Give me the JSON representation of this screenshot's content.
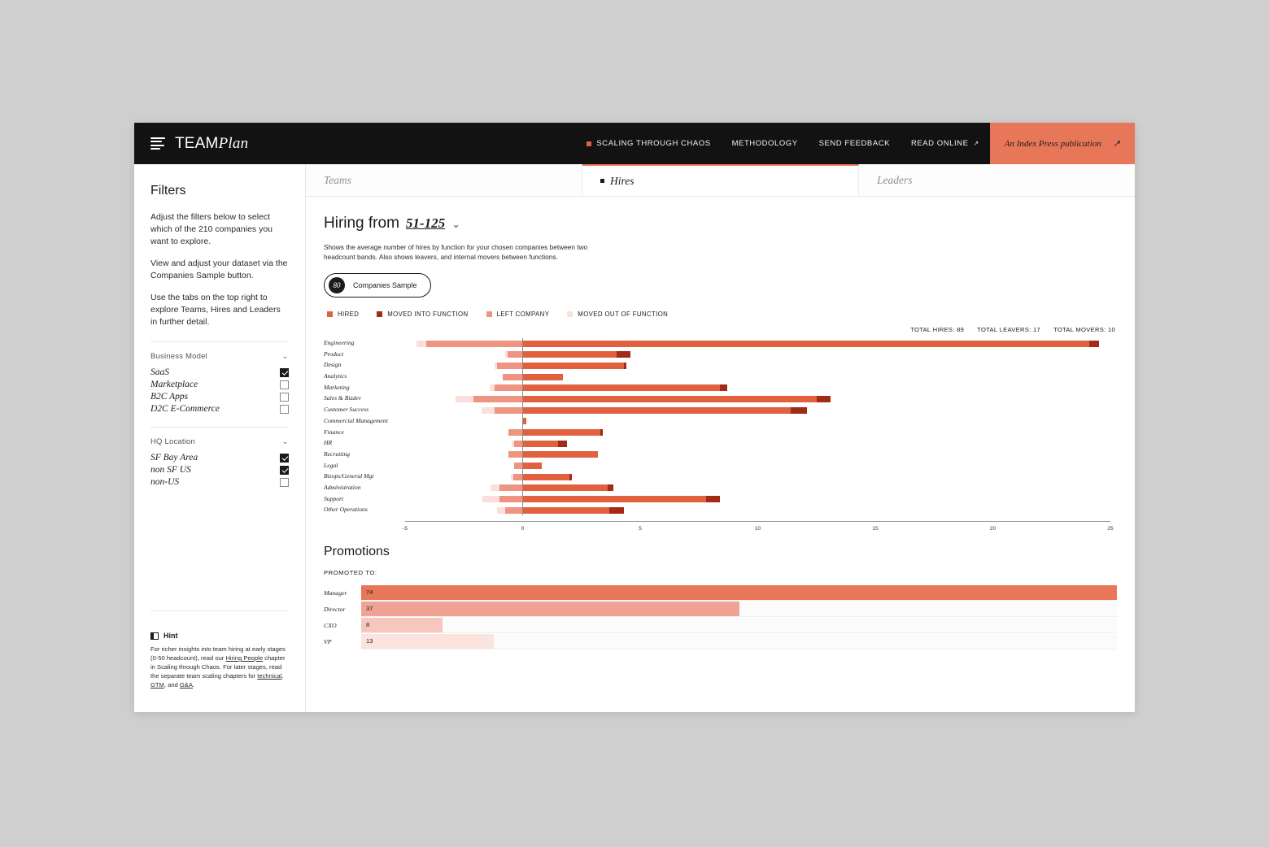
{
  "brand": {
    "name_bold": "TEAM",
    "name_italic": "Plan",
    "menu_icon": "hamburger-icon"
  },
  "topnav": {
    "items": [
      {
        "label": "SCALING THROUGH CHAOS",
        "has_square": true,
        "external": false
      },
      {
        "label": "METHODOLOGY",
        "has_square": false,
        "external": false
      },
      {
        "label": "SEND FEEDBACK",
        "has_square": false,
        "external": false
      },
      {
        "label": "READ ONLINE",
        "has_square": false,
        "external": true
      }
    ],
    "publication": "An Index Press publication",
    "publication_arrow": "↗"
  },
  "sidebar": {
    "title": "Filters",
    "paragraphs": [
      "Adjust the filters below to select which of the 210 companies you want to explore.",
      "View and adjust your dataset via the Companies Sample button.",
      "Use the tabs on the top right to explore Teams, Hires and Leaders in further detail."
    ],
    "groups": [
      {
        "title": "Business Model",
        "options": [
          {
            "label": "SaaS",
            "checked": true
          },
          {
            "label": "Marketplace",
            "checked": false
          },
          {
            "label": "B2C Apps",
            "checked": false
          },
          {
            "label": "D2C E-Commerce",
            "checked": false
          }
        ]
      },
      {
        "title": "HQ Location",
        "options": [
          {
            "label": "SF Bay Area",
            "checked": true
          },
          {
            "label": "non SF US",
            "checked": true
          },
          {
            "label": "non-US",
            "checked": false
          }
        ]
      }
    ],
    "hint": {
      "title": "Hint",
      "text_parts": [
        {
          "t": "For richer insights into team hiring at early stages (0-50 headcount), read our ",
          "u": false
        },
        {
          "t": "Hiring People",
          "u": true
        },
        {
          "t": " chapter in Scaling through Chaos. For later stages, read the separate team scaling chapters for ",
          "u": false
        },
        {
          "t": "technical",
          "u": true
        },
        {
          "t": ", ",
          "u": false
        },
        {
          "t": "GTM",
          "u": true
        },
        {
          "t": ", and ",
          "u": false
        },
        {
          "t": "G&A",
          "u": true
        },
        {
          "t": ".",
          "u": false
        }
      ]
    }
  },
  "tabs": [
    {
      "label": "Teams",
      "active": false
    },
    {
      "label": "Hires",
      "active": true
    },
    {
      "label": "Leaders",
      "active": false
    }
  ],
  "main": {
    "heading_prefix": "Hiring from",
    "heading_band": "51-125",
    "chevron": "⌄",
    "description": "Shows the average number of hires by function for your chosen companies between two headcount bands. Also shows leavers, and internal movers between functions.",
    "sample_button": {
      "badge": "80",
      "label": "Companies Sample"
    },
    "totals": [
      "TOTAL HIRES: 89",
      "TOTAL LEAVERS: 17",
      "TOTAL MOVERS: 10"
    ],
    "promotions_title": "Promotions",
    "promoted_to_label": "PROMOTED TO:"
  },
  "colors": {
    "hired": "#E1613F",
    "moved_into_function": "#A02B16",
    "left_company": "#EE9480",
    "moved_out_of_function": "#FAE0DA",
    "accent": "#E8775A",
    "dark": "#121212"
  },
  "chart_data": [
    {
      "type": "bar",
      "orientation": "horizontal",
      "title": "Hiring from 51-125",
      "xlabel": "",
      "ylabel": "",
      "xlim": [
        -5,
        25
      ],
      "xticks": [
        -5,
        0,
        5,
        10,
        15,
        20,
        25
      ],
      "grid": false,
      "legend": [
        {
          "name": "HIRED",
          "color": "#E1613F"
        },
        {
          "name": "MOVED INTO FUNCTION",
          "color": "#A02B16"
        },
        {
          "name": "LEFT COMPANY",
          "color": "#EE9480"
        },
        {
          "name": "MOVED OUT OF FUNCTION",
          "color": "#FAE0DA"
        }
      ],
      "categories": [
        "Engineering",
        "Product",
        "Design",
        "Analytics",
        "Marketing",
        "Sales & Bizdev",
        "Customer Success",
        "Commercial Management",
        "Finance",
        "HR",
        "Recruiting",
        "Legal",
        "Bizops/General Mgt",
        "Administration",
        "Support",
        "Other Operations"
      ],
      "series": [
        {
          "name": "HIRED",
          "values": [
            24.1,
            4.0,
            4.3,
            1.7,
            8.4,
            12.5,
            11.4,
            0.15,
            3.3,
            1.5,
            3.2,
            0.8,
            2.0,
            3.6,
            7.8,
            3.7
          ]
        },
        {
          "name": "MOVED INTO FUNCTION",
          "values": [
            0.4,
            0.6,
            0.1,
            0.0,
            0.3,
            0.6,
            0.7,
            0.0,
            0.1,
            0.4,
            0.0,
            0.0,
            0.1,
            0.25,
            0.6,
            0.6
          ]
        },
        {
          "name": "LEFT COMPANY",
          "values": [
            -4.1,
            -0.65,
            -1.1,
            -0.85,
            -1.2,
            -2.1,
            -1.2,
            0.0,
            -0.6,
            -0.35,
            -0.6,
            -0.35,
            -0.4,
            -1.0,
            -1.0,
            -0.75
          ]
        },
        {
          "name": "MOVED OUT OF FUNCTION",
          "values": [
            -0.4,
            -0.1,
            -0.1,
            0.0,
            -0.2,
            -0.75,
            -0.55,
            0.0,
            0.0,
            -0.1,
            0.0,
            0.0,
            -0.1,
            -0.35,
            -0.7,
            -0.35
          ]
        }
      ]
    },
    {
      "type": "bar",
      "orientation": "horizontal",
      "title": "Promotions",
      "subtitle": "PROMOTED TO:",
      "categories": [
        "Manager",
        "Director",
        "CXO",
        "VP"
      ],
      "values": [
        74,
        37,
        8,
        13
      ],
      "max": 74,
      "colors": [
        "#E8775A",
        "#F0A394",
        "#F7C6BC",
        "#FBE3DE"
      ],
      "xlabel": "",
      "ylabel": "",
      "grid": false
    }
  ]
}
